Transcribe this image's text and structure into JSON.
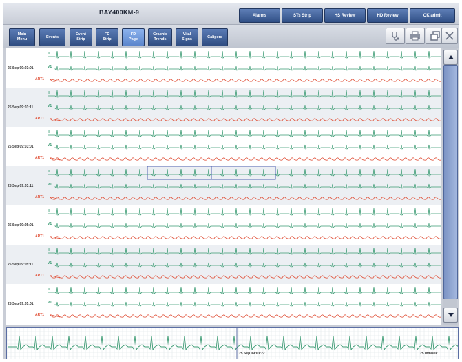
{
  "header": {
    "patient_id": "BAY400KM-9",
    "tabs": [
      {
        "label": "Alarms"
      },
      {
        "label": "STs Strip"
      },
      {
        "label": "HS Review"
      },
      {
        "label": "HD Review"
      },
      {
        "label": "OK admit"
      }
    ]
  },
  "toolbar": {
    "buttons": [
      {
        "line1": "Main",
        "line2": "Menu"
      },
      {
        "line1": "Events",
        "line2": ""
      },
      {
        "line1": "Event",
        "line2": "Strip"
      },
      {
        "line1": "FD",
        "line2": "Strip"
      },
      {
        "line1": "FD",
        "line2": "Page"
      },
      {
        "line1": "Graphic",
        "line2": "Trends"
      },
      {
        "line1": "Vital",
        "line2": "Signs"
      },
      {
        "line1": "Calipers",
        "line2": ""
      }
    ],
    "active_button": "FD Page",
    "icons": [
      "stethoscope-icon",
      "printer-icon",
      "restore-window-icon",
      "close-icon"
    ]
  },
  "strips": [
    {
      "time": "25 Sep 09:03:01",
      "leads": [
        "II",
        "V1",
        "ART1"
      ]
    },
    {
      "time": "25 Sep 09:03:11",
      "leads": [
        "II",
        "V1",
        "ART1"
      ]
    },
    {
      "time": "25 Sep 09:03:01",
      "leads": [
        "II",
        "V1",
        "ART1"
      ]
    },
    {
      "time": "25 Sep 09:03:11",
      "leads": [
        "II",
        "V1",
        "ART1"
      ]
    },
    {
      "time": "25 Sep 09:05:01",
      "leads": [
        "II",
        "V1",
        "ART1"
      ]
    },
    {
      "time": "25 Sep 09:05:11",
      "leads": [
        "II",
        "V1",
        "ART1"
      ]
    },
    {
      "time": "25 Sep 09:05:01",
      "leads": [
        "II",
        "V1",
        "ART1"
      ]
    }
  ],
  "overview": {
    "timestamp": "25 Sep 09:03:22",
    "speed": "25 mm/sec"
  },
  "colors": {
    "ecg": "#3a9a72",
    "art": "#e0523a",
    "highlight": "#4f63b0"
  }
}
